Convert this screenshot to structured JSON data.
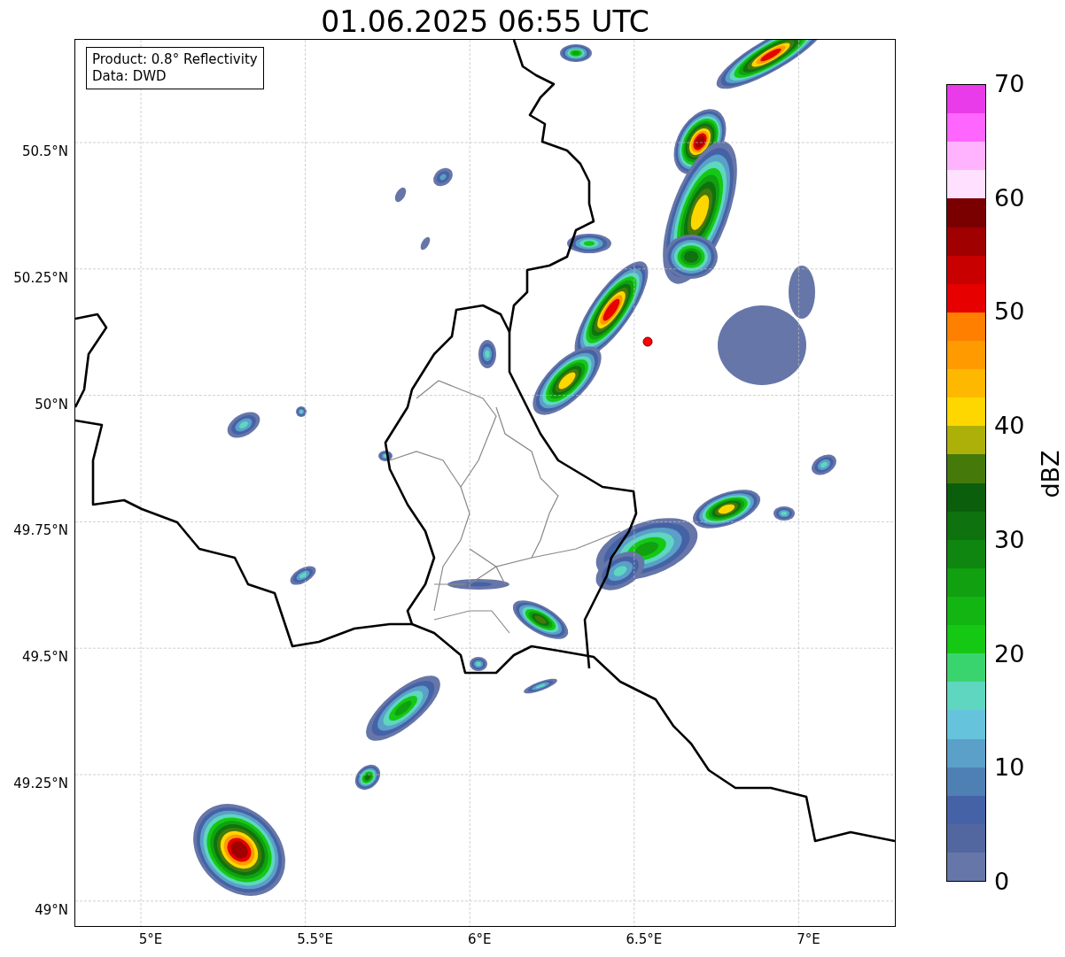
{
  "title": "01.06.2025 06:55 UTC",
  "info_box": [
    "Product: 0.8° Reflectivity",
    "Data: DWD"
  ],
  "y_ticks": [
    "50.5°N",
    "50.25°N",
    "50°N",
    "49.75°N",
    "49.5°N",
    "49.25°N",
    "49°N"
  ],
  "x_ticks": [
    "5°E",
    "5.5°E",
    "6°E",
    "6.5°E",
    "7°E"
  ],
  "colorbar": {
    "label": "dBZ",
    "ticks": [
      "70",
      "60",
      "50",
      "40",
      "30",
      "20",
      "10",
      "0"
    ],
    "bands": [
      {
        "color": "#e93be9"
      },
      {
        "color": "#ff66ff"
      },
      {
        "color": "#ffb3ff"
      },
      {
        "color": "#ffe0ff"
      },
      {
        "color": "#7a0000"
      },
      {
        "color": "#a00000"
      },
      {
        "color": "#c80000"
      },
      {
        "color": "#e60000"
      },
      {
        "color": "#ff7f00"
      },
      {
        "color": "#ff9a00"
      },
      {
        "color": "#ffb800"
      },
      {
        "color": "#ffd700"
      },
      {
        "color": "#aeb00a"
      },
      {
        "color": "#457a0a"
      },
      {
        "color": "#0b5e0b"
      },
      {
        "color": "#0e730e"
      },
      {
        "color": "#0f860f"
      },
      {
        "color": "#10a010"
      },
      {
        "color": "#12b512"
      },
      {
        "color": "#14c814"
      },
      {
        "color": "#3ad46e"
      },
      {
        "color": "#5fd6c0"
      },
      {
        "color": "#65c3dc"
      },
      {
        "color": "#5aa0c8"
      },
      {
        "color": "#4f80b4"
      },
      {
        "color": "#4662a6"
      },
      {
        "color": "#5266a0"
      },
      {
        "color": "#6676a8"
      }
    ]
  }
}
